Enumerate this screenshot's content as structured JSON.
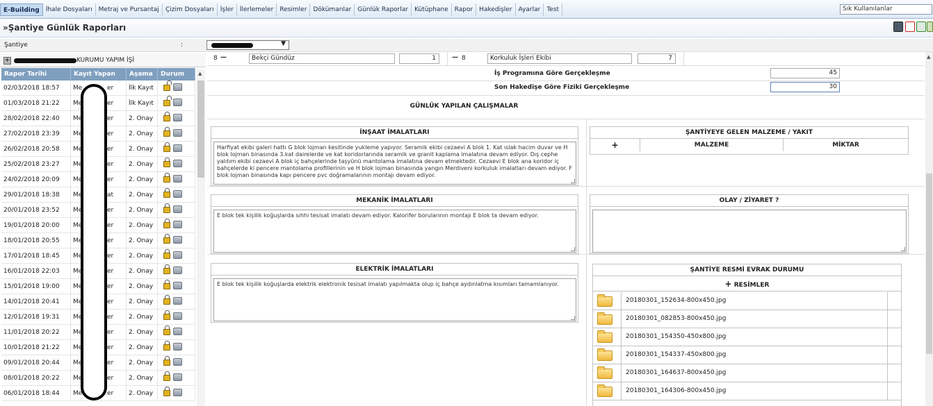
{
  "menu": [
    {
      "label": "E-Building",
      "active": true
    },
    {
      "label": "İhale Dosyaları"
    },
    {
      "label": "Metraj ve Pursantaj"
    },
    {
      "label": "Çizim Dosyaları"
    },
    {
      "label": "İşler"
    },
    {
      "label": "İlerlemeler"
    },
    {
      "label": "Resimler"
    },
    {
      "label": "Dökümanlar"
    },
    {
      "label": "Günlük Raporlar"
    },
    {
      "label": "Kütüphane"
    },
    {
      "label": "Rapor"
    },
    {
      "label": "Hakedişler"
    },
    {
      "label": "Ayarlar"
    },
    {
      "label": "Test"
    }
  ],
  "quick_select": "Sık Kullanılanlar",
  "page_title": "»Şantiye Günlük Raporları",
  "filter": {
    "label": "Şantiye",
    "colon": ":"
  },
  "left": {
    "project_suffix": "KURUMU YAPIM İŞİ",
    "expand_symbol": "+",
    "columns": [
      "Rapor Tarihi",
      "Kayıt Yapan",
      "Aşama",
      "Durum"
    ],
    "rows": [
      {
        "date": "02/03/2018 18:57",
        "user_start": "Me",
        "user_end": "er",
        "stage": "İlk Kayıt",
        "open": true
      },
      {
        "date": "01/03/2018 21:22",
        "user_start": "Me",
        "user_end": "er",
        "stage": "İlk Kayıt",
        "open": true
      },
      {
        "date": "28/02/2018 22:40",
        "user_start": "Me",
        "user_end": "er",
        "stage": "2. Onay",
        "open": false
      },
      {
        "date": "27/02/2018 23:39",
        "user_start": "Me",
        "user_end": "er",
        "stage": "2. Onay",
        "open": false
      },
      {
        "date": "26/02/2018 20:58",
        "user_start": "Me",
        "user_end": "er",
        "stage": "2. Onay",
        "open": false
      },
      {
        "date": "25/02/2018 23:27",
        "user_start": "Me",
        "user_end": "er",
        "stage": "2. Onay",
        "open": false
      },
      {
        "date": "24/02/2018 20:09",
        "user_start": "Me",
        "user_end": "er",
        "stage": "2. Onay",
        "open": false
      },
      {
        "date": "29/01/2018 18:38",
        "user_start": "Me",
        "user_end": "at",
        "stage": "2. Onay",
        "open": false
      },
      {
        "date": "20/01/2018 23:52",
        "user_start": "Me",
        "user_end": "er",
        "stage": "2. Onay",
        "open": false
      },
      {
        "date": "19/01/2018 20:00",
        "user_start": "Me",
        "user_end": "er",
        "stage": "2. Onay",
        "open": false
      },
      {
        "date": "18/01/2018 20:55",
        "user_start": "Me",
        "user_end": "er",
        "stage": "2. Onay",
        "open": false
      },
      {
        "date": "17/01/2018 18:45",
        "user_start": "Me",
        "user_end": "er",
        "stage": "2. Onay",
        "open": false
      },
      {
        "date": "16/01/2018 22:03",
        "user_start": "Me",
        "user_end": "er",
        "stage": "2. Onay",
        "open": false
      },
      {
        "date": "15/01/2018 19:00",
        "user_start": "Me",
        "user_end": "er",
        "stage": "2. Onay",
        "open": false
      },
      {
        "date": "14/01/2018 20:41",
        "user_start": "Me",
        "user_end": "er",
        "stage": "2. Onay",
        "open": false
      },
      {
        "date": "12/01/2018 19:31",
        "user_start": "Me",
        "user_end": "er",
        "stage": "2. Onay",
        "open": false
      },
      {
        "date": "11/01/2018 20:22",
        "user_start": "Me",
        "user_end": "er",
        "stage": "2. Onay",
        "open": false
      },
      {
        "date": "10/01/2018 21:22",
        "user_start": "Me",
        "user_end": "er",
        "stage": "2. Onay",
        "open": false
      },
      {
        "date": "09/01/2018 20:44",
        "user_start": "Me",
        "user_end": "er",
        "stage": "2. Onay",
        "open": false
      },
      {
        "date": "08/01/2018 20:22",
        "user_start": "Me",
        "user_end": "er",
        "stage": "2. Onay",
        "open": false
      },
      {
        "date": "06/01/2018 18:44",
        "user_start": "Me",
        "user_end": "er",
        "stage": "2. Onay",
        "open": false
      }
    ]
  },
  "right": {
    "top_row": {
      "left_num": "8",
      "left_sym": "—",
      "left_name": "Bekçi Gündüz",
      "left_count": "1",
      "right_sym": "—",
      "right_num": "8",
      "right_name": "Korkuluk İşleri Ekibi",
      "right_count": "7"
    },
    "progress1_label": "İş Programına Göre Gerçekleşme",
    "progress1_value": "45",
    "progress2_label": "Son Hakedişe Göre Fiziki Gerçekleşme",
    "progress2_value": "30",
    "daily_title": "GÜNLÜK YAPILAN ÇALIŞMALAR",
    "insaat_title": "İNŞAAT İMALATLARI",
    "insaat_text": "Harfiyat ekibi galeri hattı G blok lojman kesitinde yukleme yapıyor. Seramik ekibi cezaevi A blok 1. Kat ıslak hacim duvar ve H blok lojman binasında 3.kat dairelerde ve kat koridorlarında seramik ve granit kaplama imalatına devam ediyor. Dış cephe yalıtım ekibi cezaevi A blok iç bahçelerinde taşyünü mantolama imalatına devam etmektedir. Cezaevi E blok ana koridor iç bahçelerde ki pencere mantolama profillerinin ve H blok lojman binasında yangın Merdiveni korkuluk imalatları devam ediyor. F blok lojman binasında kapı pencere pvc doğramalarının montajı devam ediyor.",
    "material_title": "ŞANTİYEYE GELEN MALZEME / YAKIT",
    "material_add": "+",
    "material_col": "MALZEME",
    "quantity_col": "MİKTAR",
    "mekanik_title": "MEKANİK İMALATLARI",
    "mekanik_text": "E blok tek kişilik koğuşlarda sıhhi tesisat imalatı devam ediyor. Kalorifer borularının montajı E blok ta devam ediyor.",
    "olay_title": "OLAY / ZİYARET ?",
    "olay_text": "",
    "elektrik_title": "ELEKTRİK İMALATLARI",
    "elektrik_text": "E blok tek kişilik koğuşlarda elektrik elektronik tesisat imalatı yapılmakta olup iç bahçe aydınlatma  kısımları tamamlanıyor.",
    "evrak_title": "ŞANTİYE RESMİ EVRAK DURUMU",
    "images_label": "RESİMLER",
    "images_plus": "+",
    "images": [
      "20180301_152634-800x450.jpg",
      "20180301_082853-800x450.jpg",
      "20180301_154350-450x800.jpg",
      "20180301_154337-450x800.jpg",
      "20180301_164637-800x450.jpg",
      "20180301_164306-800x450.jpg"
    ]
  },
  "colors": {
    "grid_header": "#7f9fbf",
    "lock": "#e3b321",
    "folder": "#f0b93d",
    "pdf_red": "#cc2222",
    "excel_green": "#2f8a2f"
  }
}
